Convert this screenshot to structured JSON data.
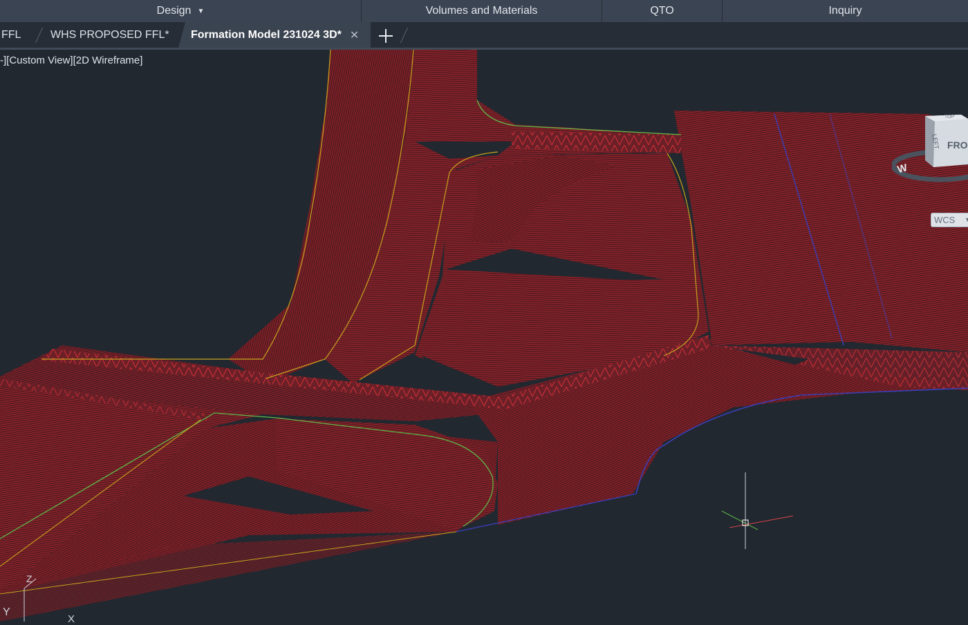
{
  "ribbon": {
    "panels": [
      {
        "label": "Design",
        "has_dropdown": true
      },
      {
        "label": "Volumes and Materials"
      },
      {
        "label": "QTO"
      },
      {
        "label": "Inquiry"
      }
    ]
  },
  "tabs": {
    "items": [
      {
        "label": "FFL"
      },
      {
        "label": "WHS PROPOSED FFL*"
      },
      {
        "label": "Formation Model 231024 3D*",
        "active": true
      }
    ],
    "close_glyph": "✕",
    "new_tab_icon": "plus-icon"
  },
  "viewport": {
    "label": "-][Custom View][2D Wireframe]",
    "viewcube": {
      "face_front": "FRONT",
      "face_left": "LEFT",
      "face_top": "TOP",
      "compass_letter": "W"
    },
    "wcs_label": "WCS",
    "ucs_axis_labels": {
      "y": "Y",
      "x": "X",
      "z": "Z"
    }
  },
  "colors": {
    "background": "#212830",
    "ribbon": "#3b4453",
    "tab_active": "#3a4350",
    "wireframe_red": "#b0262c",
    "feature_line_yellow": "#c8a41e",
    "feature_line_green": "#5fb84a",
    "boundary_blue": "#3b3fb8"
  }
}
